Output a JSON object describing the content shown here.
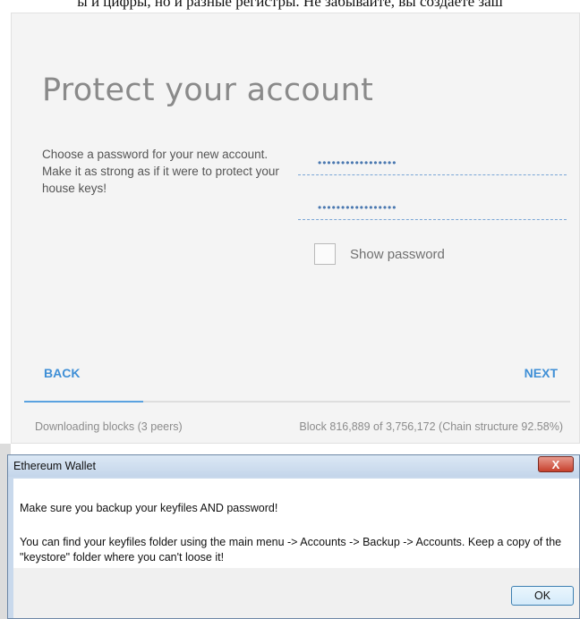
{
  "caption": {
    "text": "ы и цифры, но и разные регистры. Не забывайте, вы создаете заш"
  },
  "wallet": {
    "title": "Protect your account",
    "description": "Choose a password for your new account. Make it as strong as if it were to protect your house keys!",
    "password_field_1": {
      "masked_value": "•••••••••••••••••"
    },
    "password_field_2": {
      "masked_value": "•••••••••••••••••"
    },
    "show_password_label": "Show password",
    "show_password_checked": false,
    "back_label": "BACK",
    "next_label": "NEXT",
    "sync_progress_fraction": 0.2176,
    "status_left": "Downloading blocks (3 peers)",
    "status_right": "Block 816,889 of 3,756,172 (Chain structure 92.58%)"
  },
  "dialog": {
    "title": "Ethereum Wallet",
    "close_label": "X",
    "message_1": "Make sure you backup your keyfiles AND password!",
    "message_2": "You can find your keyfiles folder using the main menu -> Accounts -> Backup -> Accounts. Keep a copy of the \"keystore\" folder where you can't loose it!",
    "ok_label": "OK"
  },
  "colors": {
    "accent": "#3f8fd6",
    "progress": "#5aa2e0",
    "window_bg": "#f4f4f4"
  }
}
